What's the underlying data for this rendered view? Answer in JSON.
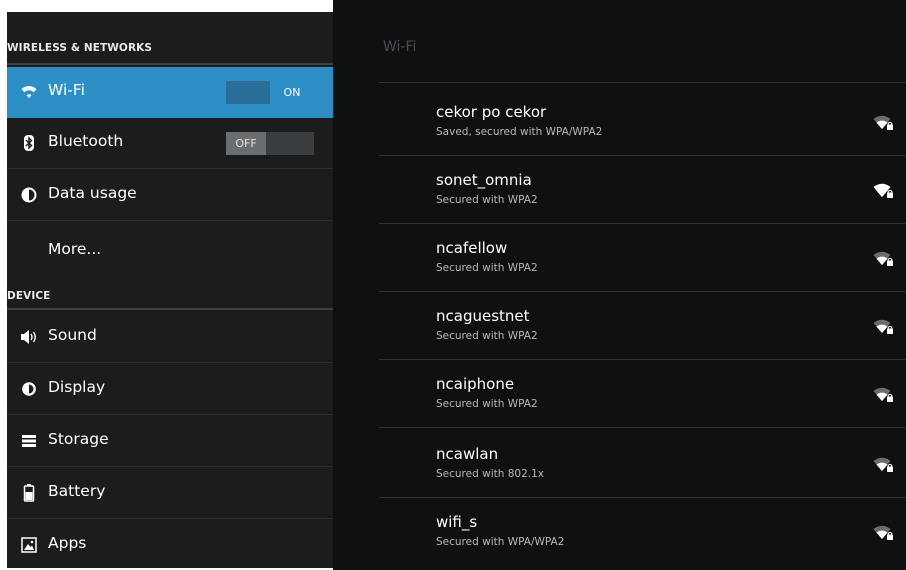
{
  "settings": {
    "wireless_header": "WIRELESS & NETWORKS",
    "device_header": "DEVICE",
    "items": [
      {
        "label": "Wi-Fi",
        "icon": "wifi-icon"
      },
      {
        "label": "Bluetooth",
        "icon": "bluetooth-icon"
      },
      {
        "label": "Data usage",
        "icon": "data-usage-icon"
      },
      {
        "label": "More...",
        "icon": ""
      },
      {
        "label": "Sound",
        "icon": "sound-icon"
      },
      {
        "label": "Display",
        "icon": "display-icon"
      },
      {
        "label": "Storage",
        "icon": "storage-icon"
      },
      {
        "label": "Battery",
        "icon": "battery-icon"
      },
      {
        "label": "Apps",
        "icon": "apps-icon"
      }
    ],
    "wifi_toggle": "ON",
    "bluetooth_toggle": "OFF"
  },
  "wifi": {
    "title": "Wi-Fi",
    "networks": [
      {
        "name": "cekor po cekor",
        "status": "Saved, secured with WPA/WPA2"
      },
      {
        "name": "sonet_omnia",
        "status": "Secured with WPA2"
      },
      {
        "name": "ncafellow",
        "status": "Secured with WPA2"
      },
      {
        "name": "ncaguestnet",
        "status": "Secured with WPA2"
      },
      {
        "name": "ncaiphone",
        "status": "Secured with WPA2"
      },
      {
        "name": "ncawlan",
        "status": "Secured with 802.1x"
      },
      {
        "name": "wifi_s",
        "status": "Secured with WPA/WPA2"
      }
    ]
  },
  "colors": {
    "accent": "#2e8fc7",
    "panel_left": "#1a1c1e",
    "panel_right": "#0f1012"
  }
}
